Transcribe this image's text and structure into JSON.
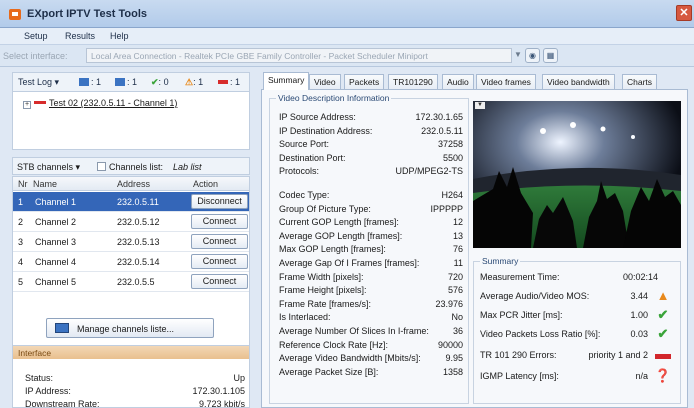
{
  "app": {
    "title": "EXport IPTV Test Tools",
    "close_glyph": "✕"
  },
  "menu": {
    "items": [
      "Setup",
      "Results",
      "Help"
    ]
  },
  "interface_bar": {
    "label": "Select interface:",
    "value": "Local Area Connection - Realtek PCIe GBE Family Controller - Packet Scheduler Miniport"
  },
  "test_log": {
    "label": "Test Log",
    "counts": {
      "recording_a": "1",
      "recording_b": "1",
      "ok": "0",
      "warning": "1",
      "error": "1"
    },
    "tree_item": "Test 02 (232.0.5.11 - Channel 1)"
  },
  "stb": {
    "dropdown_label": "STB channels",
    "list_label": "Channels list:",
    "list_name": "Lab list"
  },
  "channels": {
    "headers": {
      "nr": "Nr",
      "name": "Name",
      "address": "Address",
      "action": "Action"
    },
    "rows": [
      {
        "nr": "1",
        "name": "Channel 1",
        "address": "232.0.5.11",
        "action": "Disconnect",
        "selected": true
      },
      {
        "nr": "2",
        "name": "Channel 2",
        "address": "232.0.5.12",
        "action": "Connect"
      },
      {
        "nr": "3",
        "name": "Channel 3",
        "address": "232.0.5.13",
        "action": "Connect"
      },
      {
        "nr": "4",
        "name": "Channel 4",
        "address": "232.0.5.14",
        "action": "Connect"
      },
      {
        "nr": "5",
        "name": "Channel 5",
        "address": "232.0.5.5",
        "action": "Connect"
      }
    ],
    "manage_label": "Manage channels liste..."
  },
  "interface_panel": {
    "title": "Interface",
    "rows": [
      {
        "k": "Status:",
        "v": "Up"
      },
      {
        "k": "IP Address:",
        "v": "172.30.1.105"
      },
      {
        "k": "Downstream Rate:",
        "v": "9.723 kbit/s"
      }
    ]
  },
  "tabs": [
    "Summary",
    "Video",
    "Packets",
    "TR101290",
    "Audio",
    "Video frames",
    "Video bandwidth",
    "Charts"
  ],
  "video_info": {
    "title": "Video Description Information",
    "rows": [
      {
        "k": "IP Source Address:",
        "v": "172.30.1.65"
      },
      {
        "k": "IP Destination Address:",
        "v": "232.0.5.11"
      },
      {
        "k": "Source Port:",
        "v": "37258"
      },
      {
        "k": "Destination Port:",
        "v": "5500"
      },
      {
        "k": "Protocols:",
        "v": "UDP/MPEG2-TS"
      },
      {
        "k": "Codec Type:",
        "v": "H264"
      },
      {
        "k": "Group Of Picture Type:",
        "v": "IPPPPP"
      },
      {
        "k": "Current GOP Length [frames]:",
        "v": "12"
      },
      {
        "k": "Average GOP Length [frames]:",
        "v": "13"
      },
      {
        "k": "Max GOP Length [frames]:",
        "v": "76"
      },
      {
        "k": "Average Gap Of I Frames [frames]:",
        "v": "11"
      },
      {
        "k": "Frame Width [pixels]:",
        "v": "720"
      },
      {
        "k": "Frame Height [pixels]:",
        "v": "576"
      },
      {
        "k": "Frame Rate [frames/s]:",
        "v": "23.976"
      },
      {
        "k": "Is Interlaced:",
        "v": "No"
      },
      {
        "k": "Average Number Of Slices In I-frame:",
        "v": "36"
      },
      {
        "k": "Reference Clock Rate [Hz]:",
        "v": "90000"
      },
      {
        "k": "Average Video Bandwidth [Mbits/s]:",
        "v": "9.95"
      },
      {
        "k": "Average Packet Size [B]:",
        "v": "1358"
      }
    ]
  },
  "summary": {
    "title": "Summary",
    "rows": [
      {
        "k": "Measurement Time:",
        "v": "00:02:14",
        "icon": "none"
      },
      {
        "k": "Average Audio/Video MOS:",
        "v": "3.44",
        "icon": "warning-icon"
      },
      {
        "k": "Max PCR Jitter [ms]:",
        "v": "1.00",
        "icon": "check-icon"
      },
      {
        "k": "Video Packets Loss Ratio [%]:",
        "v": "0.03",
        "icon": "check-icon"
      },
      {
        "k": "TR 101 290 Errors:",
        "v": "priority 1 and 2",
        "icon": "error-bar-icon"
      },
      {
        "k": "IGMP Latency [ms]:",
        "v": "n/a",
        "icon": "igmp-icon"
      }
    ]
  },
  "colors": {
    "selected_row": "#3466b8",
    "warning": "#e8891c",
    "ok": "#3aa43a",
    "error": "#d2262b"
  }
}
